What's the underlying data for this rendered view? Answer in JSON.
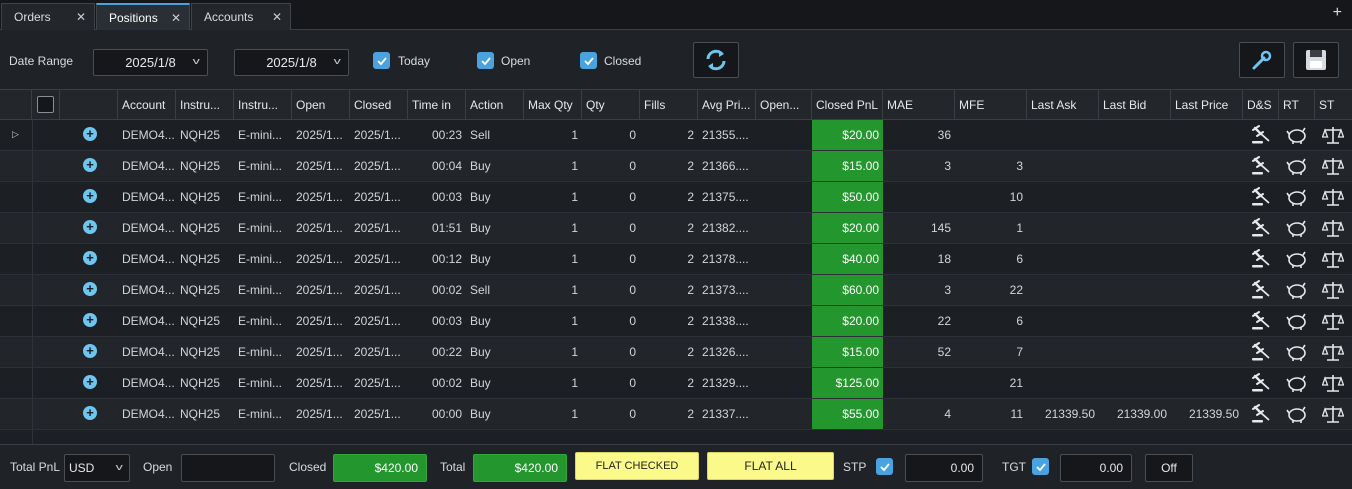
{
  "tabs": [
    {
      "label": "Orders"
    },
    {
      "label": "Positions"
    },
    {
      "label": "Accounts"
    }
  ],
  "filter": {
    "date_range_label": "Date Range",
    "date_from": "2025/1/8",
    "date_to": "2025/1/8",
    "today_label": "Today",
    "open_label": "Open",
    "closed_label": "Closed"
  },
  "columns": [
    "Account",
    "Instru...",
    "Instru...",
    "Open",
    "Closed",
    "Time in",
    "Action",
    "Max Qty",
    "Qty",
    "Fills",
    "Avg Pri...",
    "Open...",
    "Closed PnL",
    "MAE",
    "MFE",
    "Last Ask",
    "Last Bid",
    "Last Price",
    "D&S",
    "RT",
    "ST"
  ],
  "rows": [
    {
      "account": "DEMO4...",
      "instrument": "NQH25",
      "instrument_name": "E-mini...",
      "open": "2025/1...",
      "closed": "2025/1...",
      "time_in": "00:23",
      "action": "Sell",
      "max_qty": "1",
      "qty": "0",
      "fills": "2",
      "avg_price": "21355....",
      "open_pnl": "",
      "closed_pnl": "$20.00",
      "mae": "36",
      "mfe": "",
      "last_ask": "",
      "last_bid": "",
      "last_price": ""
    },
    {
      "account": "DEMO4...",
      "instrument": "NQH25",
      "instrument_name": "E-mini...",
      "open": "2025/1...",
      "closed": "2025/1...",
      "time_in": "00:04",
      "action": "Buy",
      "max_qty": "1",
      "qty": "0",
      "fills": "2",
      "avg_price": "21366....",
      "open_pnl": "",
      "closed_pnl": "$15.00",
      "mae": "3",
      "mfe": "3",
      "last_ask": "",
      "last_bid": "",
      "last_price": ""
    },
    {
      "account": "DEMO4...",
      "instrument": "NQH25",
      "instrument_name": "E-mini...",
      "open": "2025/1...",
      "closed": "2025/1...",
      "time_in": "00:03",
      "action": "Buy",
      "max_qty": "1",
      "qty": "0",
      "fills": "2",
      "avg_price": "21375....",
      "open_pnl": "",
      "closed_pnl": "$50.00",
      "mae": "",
      "mfe": "10",
      "last_ask": "",
      "last_bid": "",
      "last_price": ""
    },
    {
      "account": "DEMO4...",
      "instrument": "NQH25",
      "instrument_name": "E-mini...",
      "open": "2025/1...",
      "closed": "2025/1...",
      "time_in": "01:51",
      "action": "Buy",
      "max_qty": "1",
      "qty": "0",
      "fills": "2",
      "avg_price": "21382....",
      "open_pnl": "",
      "closed_pnl": "$20.00",
      "mae": "145",
      "mfe": "1",
      "last_ask": "",
      "last_bid": "",
      "last_price": ""
    },
    {
      "account": "DEMO4...",
      "instrument": "NQH25",
      "instrument_name": "E-mini...",
      "open": "2025/1...",
      "closed": "2025/1...",
      "time_in": "00:12",
      "action": "Buy",
      "max_qty": "1",
      "qty": "0",
      "fills": "2",
      "avg_price": "21378....",
      "open_pnl": "",
      "closed_pnl": "$40.00",
      "mae": "18",
      "mfe": "6",
      "last_ask": "",
      "last_bid": "",
      "last_price": ""
    },
    {
      "account": "DEMO4...",
      "instrument": "NQH25",
      "instrument_name": "E-mini...",
      "open": "2025/1...",
      "closed": "2025/1...",
      "time_in": "00:02",
      "action": "Sell",
      "max_qty": "1",
      "qty": "0",
      "fills": "2",
      "avg_price": "21373....",
      "open_pnl": "",
      "closed_pnl": "$60.00",
      "mae": "3",
      "mfe": "22",
      "last_ask": "",
      "last_bid": "",
      "last_price": ""
    },
    {
      "account": "DEMO4...",
      "instrument": "NQH25",
      "instrument_name": "E-mini...",
      "open": "2025/1...",
      "closed": "2025/1...",
      "time_in": "00:03",
      "action": "Buy",
      "max_qty": "1",
      "qty": "0",
      "fills": "2",
      "avg_price": "21338....",
      "open_pnl": "",
      "closed_pnl": "$20.00",
      "mae": "22",
      "mfe": "6",
      "last_ask": "",
      "last_bid": "",
      "last_price": ""
    },
    {
      "account": "DEMO4...",
      "instrument": "NQH25",
      "instrument_name": "E-mini...",
      "open": "2025/1...",
      "closed": "2025/1...",
      "time_in": "00:22",
      "action": "Buy",
      "max_qty": "1",
      "qty": "0",
      "fills": "2",
      "avg_price": "21326....",
      "open_pnl": "",
      "closed_pnl": "$15.00",
      "mae": "52",
      "mfe": "7",
      "last_ask": "",
      "last_bid": "",
      "last_price": ""
    },
    {
      "account": "DEMO4...",
      "instrument": "NQH25",
      "instrument_name": "E-mini...",
      "open": "2025/1...",
      "closed": "2025/1...",
      "time_in": "00:02",
      "action": "Buy",
      "max_qty": "1",
      "qty": "0",
      "fills": "2",
      "avg_price": "21329....",
      "open_pnl": "",
      "closed_pnl": "$125.00",
      "mae": "",
      "mfe": "21",
      "last_ask": "",
      "last_bid": "",
      "last_price": ""
    },
    {
      "account": "DEMO4...",
      "instrument": "NQH25",
      "instrument_name": "E-mini...",
      "open": "2025/1...",
      "closed": "2025/1...",
      "time_in": "00:00",
      "action": "Buy",
      "max_qty": "1",
      "qty": "0",
      "fills": "2",
      "avg_price": "21337....",
      "open_pnl": "",
      "closed_pnl": "$55.00",
      "mae": "4",
      "mfe": "11",
      "last_ask": "21339.50",
      "last_bid": "21339.00",
      "last_price": "21339.50"
    }
  ],
  "footer": {
    "total_pnl_label": "Total PnL",
    "currency": "USD",
    "open_label": "Open",
    "open_value": "",
    "closed_label": "Closed",
    "closed_value": "$420.00",
    "total_label": "Total",
    "total_value": "$420.00",
    "flat_checked_label": "FLAT CHECKED",
    "flat_all_label": "FLAT ALL",
    "stp_label": "STP",
    "stp_value": "0.00",
    "tgt_label": "TGT",
    "tgt_value": "0.00",
    "off_label": "Off"
  },
  "colors": {
    "pnl_green": "#23962d",
    "accent_blue": "#4aa3df",
    "flat_yellow": "#fbf98a"
  }
}
